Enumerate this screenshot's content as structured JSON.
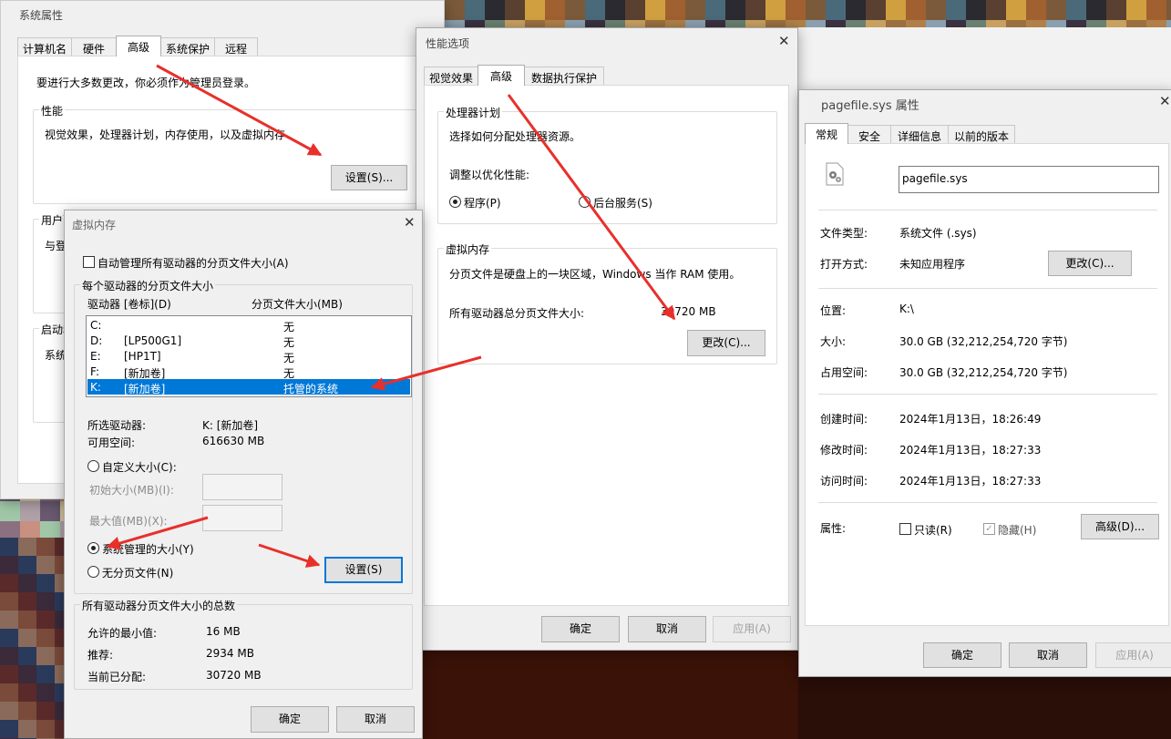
{
  "sys_props": {
    "title": "系统属性",
    "tabs": [
      "计算机名",
      "硬件",
      "高级",
      "系统保护",
      "远程"
    ],
    "admin_notice": "要进行大多数更改，你必须作为管理员登录。",
    "perf_group": "性能",
    "perf_desc": "视觉效果，处理器计划，内存使用，以及虚拟内存",
    "perf_settings_btn": "设置(S)...",
    "user_group": "用户配",
    "user_desc": "与登",
    "startup_group": "启动和",
    "startup_desc": "系统"
  },
  "vm": {
    "title": "虚拟内存",
    "close": "✕",
    "auto_manage": "自动管理所有驱动器的分页文件大小(A)",
    "per_drive_group": "每个驱动器的分页文件大小",
    "col_drive": "驱动器 [卷标](D)",
    "col_size": "分页文件大小(MB)",
    "drives": [
      {
        "letter": "C:",
        "label": "",
        "size": "无"
      },
      {
        "letter": "D:",
        "label": "[LP500G1]",
        "size": "无"
      },
      {
        "letter": "E:",
        "label": "[HP1T]",
        "size": "无"
      },
      {
        "letter": "F:",
        "label": "[新加卷]",
        "size": "无"
      },
      {
        "letter": "K:",
        "label": "[新加卷]",
        "size": "托管的系统"
      }
    ],
    "selected_drive_label": "所选驱动器:",
    "selected_drive_value": "K:  [新加卷]",
    "free_space_label": "可用空间:",
    "free_space_value": "616630 MB",
    "custom_size": "自定义大小(C):",
    "initial_size": "初始大小(MB)(I):",
    "max_size": "最大值(MB)(X):",
    "system_managed": "系统管理的大小(Y)",
    "no_paging": "无分页文件(N)",
    "set_btn": "设置(S)",
    "total_group": "所有驱动器分页文件大小的总数",
    "min_allowed_label": "允许的最小值:",
    "min_allowed_value": "16 MB",
    "recommended_label": "推荐:",
    "recommended_value": "2934 MB",
    "current_label": "当前已分配:",
    "current_value": "30720 MB",
    "ok": "确定",
    "cancel": "取消"
  },
  "perf": {
    "title": "性能选项",
    "close": "✕",
    "tabs": [
      "视觉效果",
      "高级",
      "数据执行保护"
    ],
    "sched_group": "处理器计划",
    "sched_desc": "选择如何分配处理器资源。",
    "adjust_label": "调整以优化性能:",
    "programs": "程序(P)",
    "background": "后台服务(S)",
    "vm_group": "虚拟内存",
    "vm_desc": "分页文件是硬盘上的一块区域，Windows 当作 RAM 使用。",
    "total_label": "所有驱动器总分页文件大小:",
    "total_value": "30720 MB",
    "change_btn": "更改(C)...",
    "ok": "确定",
    "cancel": "取消",
    "apply": "应用(A)"
  },
  "pagefile": {
    "title": "pagefile.sys 属性",
    "close": "✕",
    "tabs": [
      "常规",
      "安全",
      "详细信息",
      "以前的版本"
    ],
    "name": "pagefile.sys",
    "file_type_label": "文件类型:",
    "file_type_value": "系统文件 (.sys)",
    "open_with_label": "打开方式:",
    "open_with_value": "未知应用程序",
    "change_btn": "更改(C)...",
    "location_label": "位置:",
    "location_value": "K:\\",
    "size_label": "大小:",
    "size_value": "30.0 GB (32,212,254,720 字节)",
    "disk_size_label": "占用空间:",
    "disk_size_value": "30.0 GB (32,212,254,720 字节)",
    "created_label": "创建时间:",
    "created_value": "2024年1月13日，18:26:49",
    "modified_label": "修改时间:",
    "modified_value": "2024年1月13日，18:27:33",
    "accessed_label": "访问时间:",
    "accessed_value": "2024年1月13日，18:27:33",
    "attrs_label": "属性:",
    "readonly": "只读(R)",
    "hidden": "隐藏(H)",
    "check_mark": "✓",
    "advanced_btn": "高级(D)...",
    "ok": "确定",
    "cancel": "取消",
    "apply": "应用(A)"
  },
  "colors": {
    "accent": "#0078d7",
    "arrow": "#e8302a",
    "dialog": "#f0f0f0"
  },
  "icons": {
    "gear": "gear-icon",
    "close": "close-icon"
  }
}
